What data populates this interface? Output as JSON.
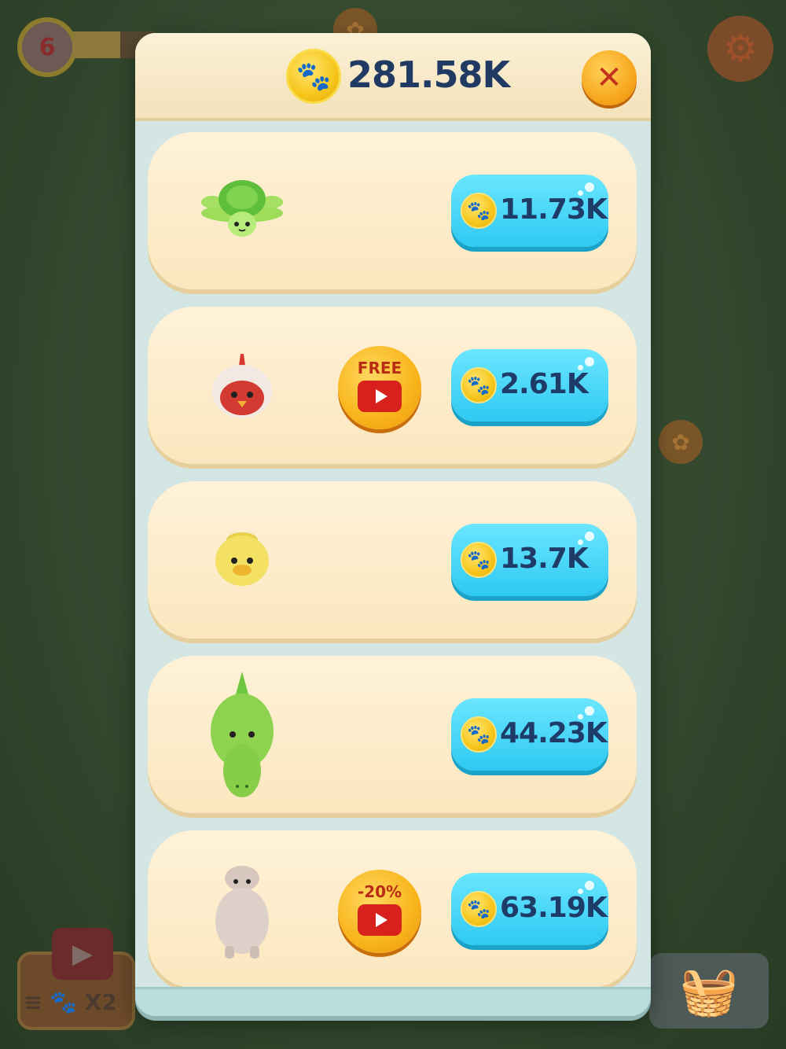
{
  "hud": {
    "level": "6",
    "level_progress": 0.55,
    "settings_icon": "gear-icon",
    "boost_label": "X2",
    "basket_icon": "basket-icon"
  },
  "shop": {
    "balance": "281.58K",
    "balance_icon": "paw-coin-icon",
    "close_icon": "close-icon",
    "items": [
      {
        "pet": "turtle",
        "price": "11.73K",
        "video": null
      },
      {
        "pet": "rooster",
        "price": "2.61K",
        "video": "FREE"
      },
      {
        "pet": "chick",
        "price": "13.7K",
        "video": null
      },
      {
        "pet": "crocodile",
        "price": "44.23K",
        "video": null
      },
      {
        "pet": "alpaca",
        "price": "63.19K",
        "video": "-20%"
      }
    ]
  },
  "colors": {
    "price_button": "#2ec9f2",
    "balance_text": "#203a63",
    "card_bg": "#fbe7bf",
    "video_button": "#f8b41a",
    "play_red": "#d8211c"
  }
}
